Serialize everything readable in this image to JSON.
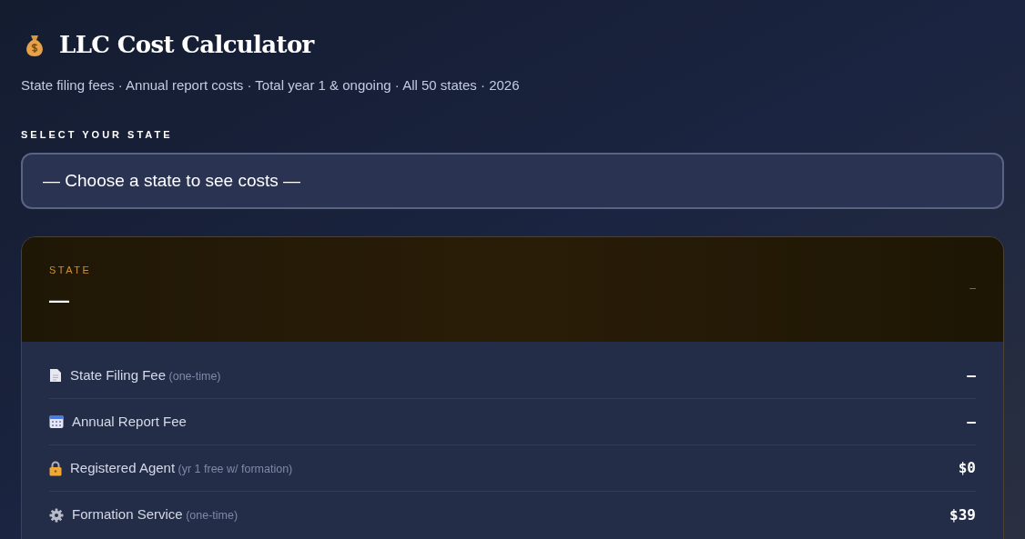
{
  "header": {
    "title": "LLC Cost Calculator",
    "subtitle": "State filing fees · Annual report costs · Total year 1 & ongoing · All 50 states · 2026"
  },
  "state_select": {
    "label": "SELECT YOUR STATE",
    "placeholder": "— Choose a state to see costs —"
  },
  "result": {
    "label": "STATE",
    "state_name": "—",
    "badge": "–",
    "rows": [
      {
        "kind": "document",
        "label": "State Filing Fee",
        "note": "(one-time)",
        "value": "–"
      },
      {
        "kind": "calendar",
        "label": "Annual Report Fee",
        "value": "–"
      },
      {
        "kind": "lock",
        "label": "Registered Agent",
        "note": "(yr 1 free w/ formation)",
        "value": "$0"
      },
      {
        "kind": "gear",
        "label": "Formation Service",
        "note": "(one-time)",
        "value": "$39"
      }
    ]
  }
}
